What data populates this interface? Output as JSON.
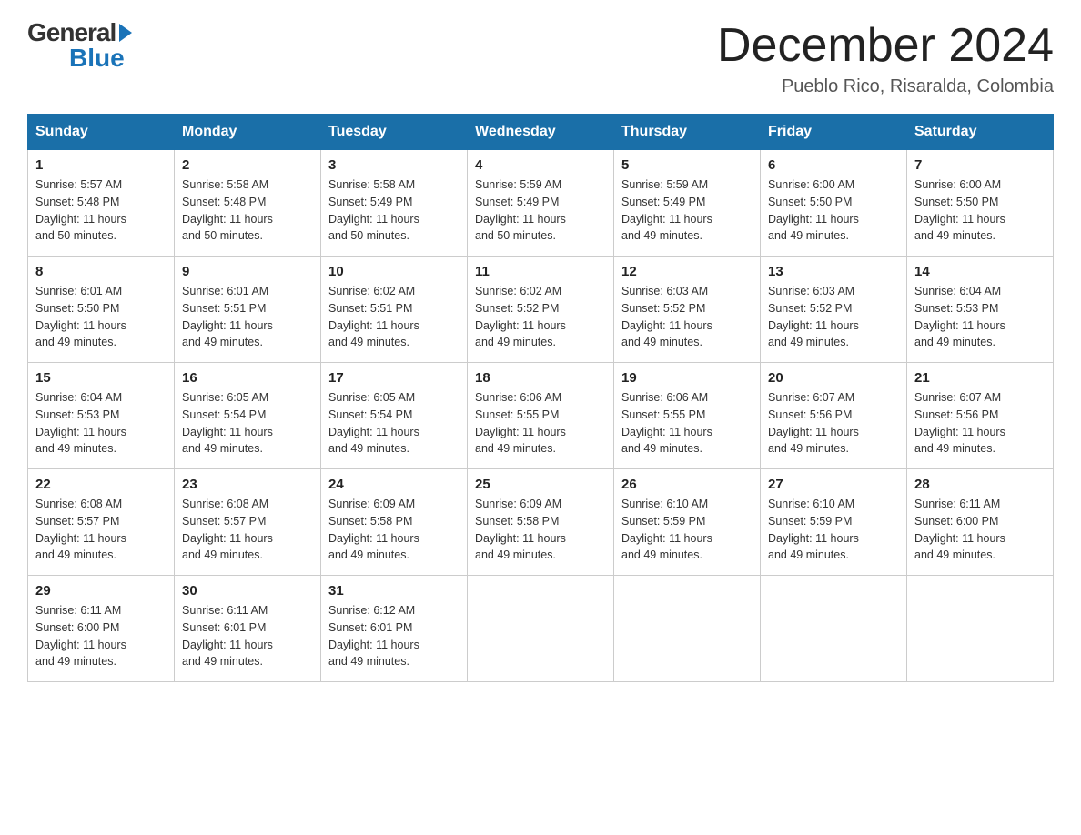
{
  "header": {
    "logo_general": "General",
    "logo_blue": "Blue",
    "month_title": "December 2024",
    "location": "Pueblo Rico, Risaralda, Colombia"
  },
  "weekdays": [
    "Sunday",
    "Monday",
    "Tuesday",
    "Wednesday",
    "Thursday",
    "Friday",
    "Saturday"
  ],
  "weeks": [
    [
      {
        "day": "1",
        "sunrise": "Sunrise: 5:57 AM",
        "sunset": "Sunset: 5:48 PM",
        "daylight": "Daylight: 11 hours and 50 minutes."
      },
      {
        "day": "2",
        "sunrise": "Sunrise: 5:58 AM",
        "sunset": "Sunset: 5:48 PM",
        "daylight": "Daylight: 11 hours and 50 minutes."
      },
      {
        "day": "3",
        "sunrise": "Sunrise: 5:58 AM",
        "sunset": "Sunset: 5:49 PM",
        "daylight": "Daylight: 11 hours and 50 minutes."
      },
      {
        "day": "4",
        "sunrise": "Sunrise: 5:59 AM",
        "sunset": "Sunset: 5:49 PM",
        "daylight": "Daylight: 11 hours and 50 minutes."
      },
      {
        "day": "5",
        "sunrise": "Sunrise: 5:59 AM",
        "sunset": "Sunset: 5:49 PM",
        "daylight": "Daylight: 11 hours and 49 minutes."
      },
      {
        "day": "6",
        "sunrise": "Sunrise: 6:00 AM",
        "sunset": "Sunset: 5:50 PM",
        "daylight": "Daylight: 11 hours and 49 minutes."
      },
      {
        "day": "7",
        "sunrise": "Sunrise: 6:00 AM",
        "sunset": "Sunset: 5:50 PM",
        "daylight": "Daylight: 11 hours and 49 minutes."
      }
    ],
    [
      {
        "day": "8",
        "sunrise": "Sunrise: 6:01 AM",
        "sunset": "Sunset: 5:50 PM",
        "daylight": "Daylight: 11 hours and 49 minutes."
      },
      {
        "day": "9",
        "sunrise": "Sunrise: 6:01 AM",
        "sunset": "Sunset: 5:51 PM",
        "daylight": "Daylight: 11 hours and 49 minutes."
      },
      {
        "day": "10",
        "sunrise": "Sunrise: 6:02 AM",
        "sunset": "Sunset: 5:51 PM",
        "daylight": "Daylight: 11 hours and 49 minutes."
      },
      {
        "day": "11",
        "sunrise": "Sunrise: 6:02 AM",
        "sunset": "Sunset: 5:52 PM",
        "daylight": "Daylight: 11 hours and 49 minutes."
      },
      {
        "day": "12",
        "sunrise": "Sunrise: 6:03 AM",
        "sunset": "Sunset: 5:52 PM",
        "daylight": "Daylight: 11 hours and 49 minutes."
      },
      {
        "day": "13",
        "sunrise": "Sunrise: 6:03 AM",
        "sunset": "Sunset: 5:52 PM",
        "daylight": "Daylight: 11 hours and 49 minutes."
      },
      {
        "day": "14",
        "sunrise": "Sunrise: 6:04 AM",
        "sunset": "Sunset: 5:53 PM",
        "daylight": "Daylight: 11 hours and 49 minutes."
      }
    ],
    [
      {
        "day": "15",
        "sunrise": "Sunrise: 6:04 AM",
        "sunset": "Sunset: 5:53 PM",
        "daylight": "Daylight: 11 hours and 49 minutes."
      },
      {
        "day": "16",
        "sunrise": "Sunrise: 6:05 AM",
        "sunset": "Sunset: 5:54 PM",
        "daylight": "Daylight: 11 hours and 49 minutes."
      },
      {
        "day": "17",
        "sunrise": "Sunrise: 6:05 AM",
        "sunset": "Sunset: 5:54 PM",
        "daylight": "Daylight: 11 hours and 49 minutes."
      },
      {
        "day": "18",
        "sunrise": "Sunrise: 6:06 AM",
        "sunset": "Sunset: 5:55 PM",
        "daylight": "Daylight: 11 hours and 49 minutes."
      },
      {
        "day": "19",
        "sunrise": "Sunrise: 6:06 AM",
        "sunset": "Sunset: 5:55 PM",
        "daylight": "Daylight: 11 hours and 49 minutes."
      },
      {
        "day": "20",
        "sunrise": "Sunrise: 6:07 AM",
        "sunset": "Sunset: 5:56 PM",
        "daylight": "Daylight: 11 hours and 49 minutes."
      },
      {
        "day": "21",
        "sunrise": "Sunrise: 6:07 AM",
        "sunset": "Sunset: 5:56 PM",
        "daylight": "Daylight: 11 hours and 49 minutes."
      }
    ],
    [
      {
        "day": "22",
        "sunrise": "Sunrise: 6:08 AM",
        "sunset": "Sunset: 5:57 PM",
        "daylight": "Daylight: 11 hours and 49 minutes."
      },
      {
        "day": "23",
        "sunrise": "Sunrise: 6:08 AM",
        "sunset": "Sunset: 5:57 PM",
        "daylight": "Daylight: 11 hours and 49 minutes."
      },
      {
        "day": "24",
        "sunrise": "Sunrise: 6:09 AM",
        "sunset": "Sunset: 5:58 PM",
        "daylight": "Daylight: 11 hours and 49 minutes."
      },
      {
        "day": "25",
        "sunrise": "Sunrise: 6:09 AM",
        "sunset": "Sunset: 5:58 PM",
        "daylight": "Daylight: 11 hours and 49 minutes."
      },
      {
        "day": "26",
        "sunrise": "Sunrise: 6:10 AM",
        "sunset": "Sunset: 5:59 PM",
        "daylight": "Daylight: 11 hours and 49 minutes."
      },
      {
        "day": "27",
        "sunrise": "Sunrise: 6:10 AM",
        "sunset": "Sunset: 5:59 PM",
        "daylight": "Daylight: 11 hours and 49 minutes."
      },
      {
        "day": "28",
        "sunrise": "Sunrise: 6:11 AM",
        "sunset": "Sunset: 6:00 PM",
        "daylight": "Daylight: 11 hours and 49 minutes."
      }
    ],
    [
      {
        "day": "29",
        "sunrise": "Sunrise: 6:11 AM",
        "sunset": "Sunset: 6:00 PM",
        "daylight": "Daylight: 11 hours and 49 minutes."
      },
      {
        "day": "30",
        "sunrise": "Sunrise: 6:11 AM",
        "sunset": "Sunset: 6:01 PM",
        "daylight": "Daylight: 11 hours and 49 minutes."
      },
      {
        "day": "31",
        "sunrise": "Sunrise: 6:12 AM",
        "sunset": "Sunset: 6:01 PM",
        "daylight": "Daylight: 11 hours and 49 minutes."
      },
      null,
      null,
      null,
      null
    ]
  ]
}
